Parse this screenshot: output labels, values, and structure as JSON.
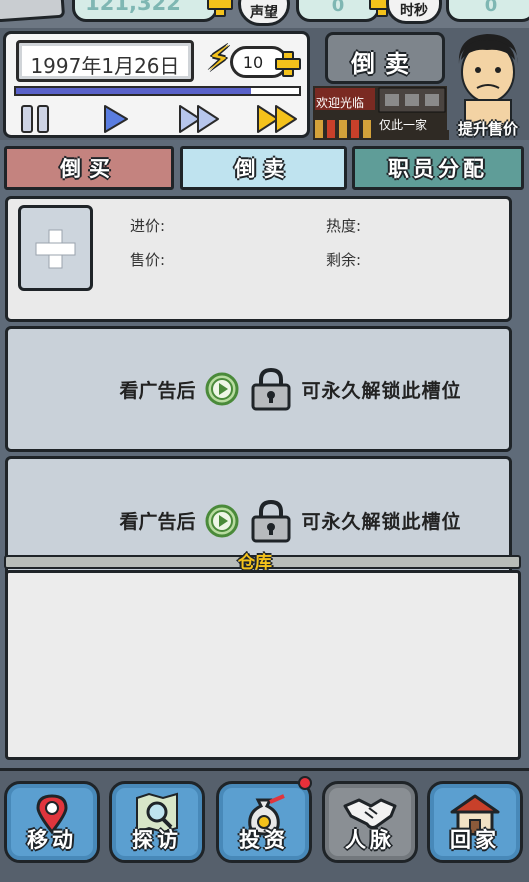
{
  "status": {
    "money": "121,322",
    "fame_label": "声望",
    "fame_value": "0",
    "time_label": "时秒",
    "time_value": "0"
  },
  "header": {
    "date": "1997年1月26日",
    "energy": "10",
    "progress_fraction": 0.83,
    "sell_button": "倒卖",
    "welcome_sign": "欢迎光临",
    "unique_sign": "仅此一家",
    "raise_price": "提升售价"
  },
  "tabs": [
    {
      "label": "倒买",
      "color": "#c4837f"
    },
    {
      "label": "倒卖",
      "color": "#bfe3ef"
    },
    {
      "label": "职员分配",
      "color": "#5f9d98"
    }
  ],
  "slot": {
    "buy_price_label": "进价:",
    "sell_price_label": "售价:",
    "heat_label": "热度:",
    "remaining_label": "剩余:"
  },
  "locked_slots": [
    {
      "text_before": "看广告后",
      "text_after": "可永久解锁此槽位"
    },
    {
      "text_before": "看广告后",
      "text_after": "可永久解锁此槽位"
    }
  ],
  "warehouse": {
    "title": "仓库"
  },
  "nav": [
    {
      "label": "移动",
      "icon": "map-pin-icon"
    },
    {
      "label": "探访",
      "icon": "map-search-icon"
    },
    {
      "label": "投资",
      "icon": "money-bag-icon"
    },
    {
      "label": "人脉",
      "icon": "handshake-icon"
    },
    {
      "label": "回家",
      "icon": "house-icon"
    }
  ],
  "colors": {
    "accent_yellow": "#f4c21b",
    "progress_blue": "#5a62c9",
    "nav_blue": "#5b9fd0"
  }
}
